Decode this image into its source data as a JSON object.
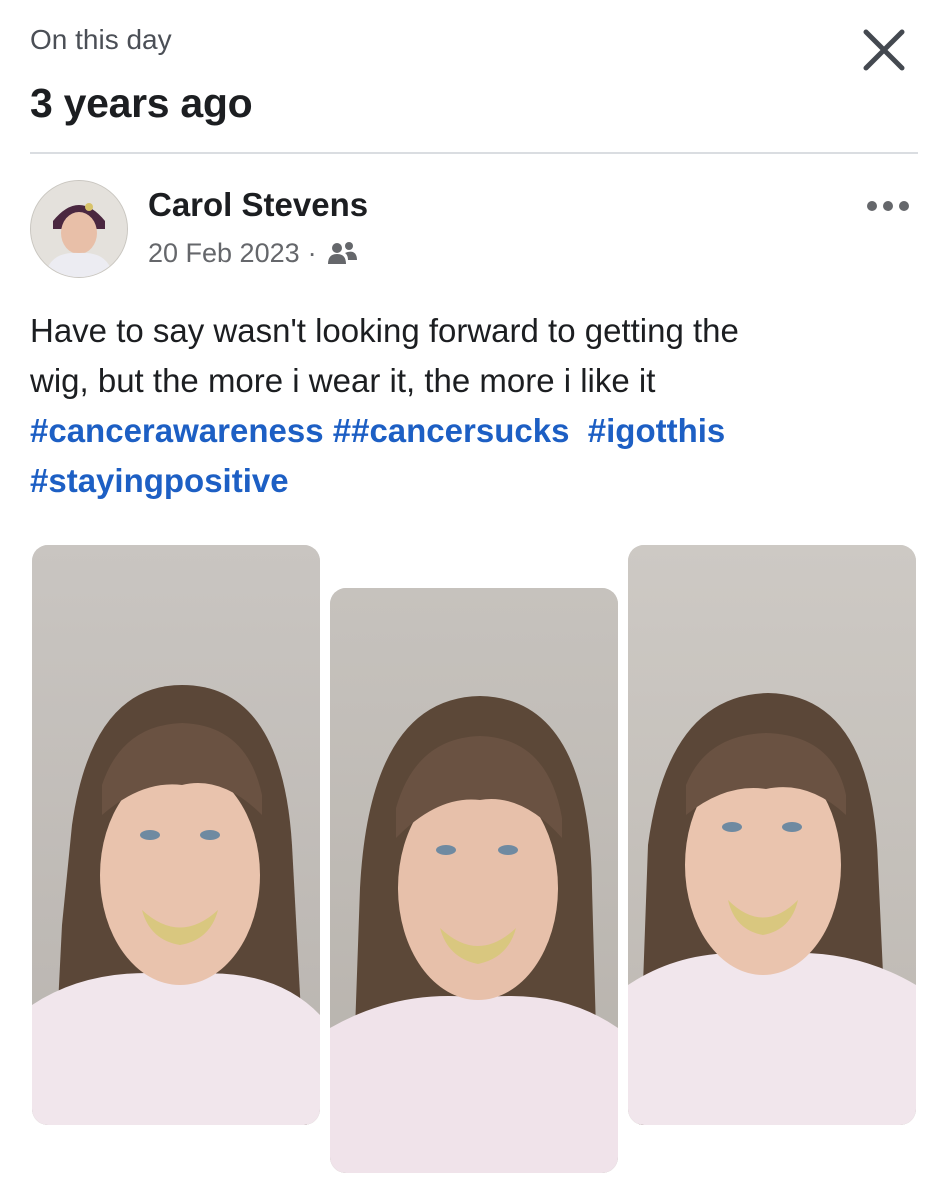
{
  "memory": {
    "kicker": "On this day",
    "headline": "3 years ago",
    "close_icon": "close-icon"
  },
  "post": {
    "author": "Carol Stevens",
    "date": "20 Feb 2023",
    "separator": "·",
    "audience_icon": "friends-icon",
    "more_icon": "more-options-icon",
    "text_line_1": "Have to say wasn't looking forward to getting the",
    "text_line_2": "wig, but the more i wear it, the more i like it",
    "hashtags": {
      "tag1": "#cancerawareness",
      "tag2": "##cancersucks",
      "tag3": "#igotthis",
      "tag4": "#stayingpositive"
    },
    "photo_count": 3
  },
  "colors": {
    "hashtag": "#1d5fc4",
    "text": "#1c1e21",
    "secondary": "#65676b",
    "divider": "#dadde1"
  }
}
